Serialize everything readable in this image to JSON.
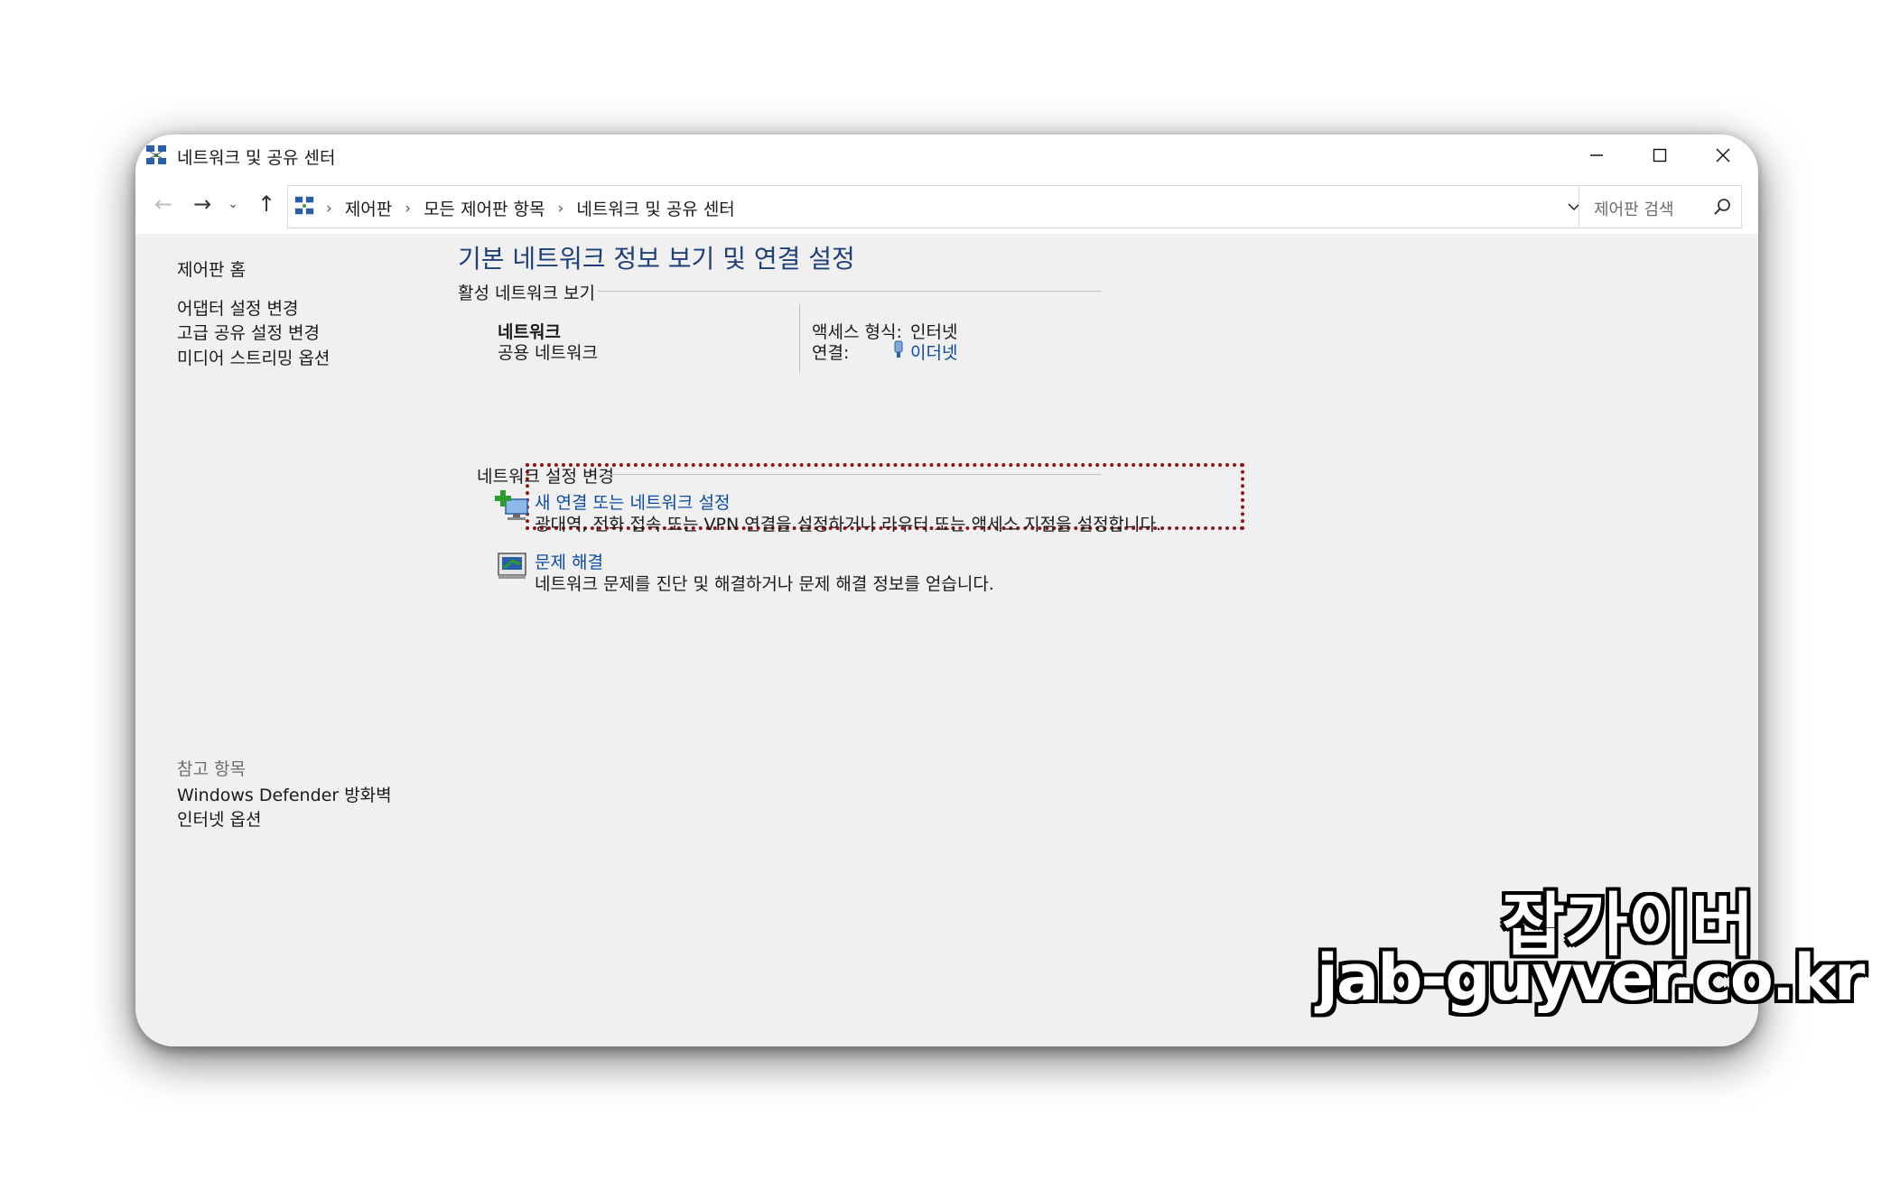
{
  "window": {
    "title": "네트워크 및 공유 센터"
  },
  "navbar": {
    "breadcrumbs": [
      "제어판",
      "모든 제어판 항목",
      "네트워크 및 공유 센터"
    ],
    "search_placeholder": "제어판 검색"
  },
  "sidebar": {
    "home": "제어판 홈",
    "links": [
      "어댑터 설정 변경",
      "고급 공유 설정 변경",
      "미디어 스트리밍 옵션"
    ],
    "see_also_title": "참고 항목",
    "see_also": [
      "Windows Defender 방화벽",
      "인터넷 옵션"
    ]
  },
  "main": {
    "title": "기본 네트워크 정보 보기 및 연결 설정",
    "active_section": "활성 네트워크 보기",
    "network_name": "네트워크",
    "network_type": "공용 네트워크",
    "access_type_label": "액세스 형식:",
    "access_type_value": "인터넷",
    "connection_label": "연결:",
    "connection_value": "이더넷",
    "change_section": "네트워크 설정 변경",
    "task1_title": "새 연결 또는 네트워크 설정",
    "task1_desc": "광대역, 전화 접속 또는 VPN 연결을 설정하거나 라우터 또는 액세스 지점을 설정합니다.",
    "task2_title": "문제 해결",
    "task2_desc": "네트워크 문제를 진단 및 해결하거나 문제 해결 정보를 얻습니다."
  },
  "watermark": {
    "korean": "잡가이버",
    "url": "jab-guyver.co.kr"
  },
  "colors": {
    "link": "#0a4aa6",
    "title": "#1e3f7a",
    "highlight_border": "#8e1414"
  }
}
